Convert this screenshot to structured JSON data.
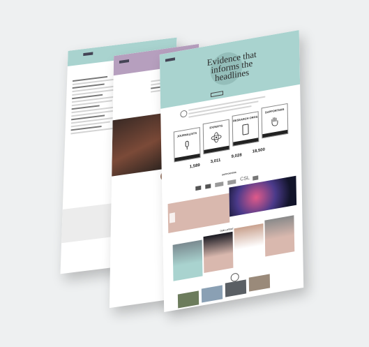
{
  "hero": {
    "title": "Evidence that informs the headlines"
  },
  "audiences": [
    {
      "label": "JOURNALISTS",
      "icon": "microphone-icon"
    },
    {
      "label": "EXPERTS",
      "icon": "atom-icon"
    },
    {
      "label": "RESEARCH ORGS",
      "icon": "phone-icon"
    },
    {
      "label": "SUPPORTERS",
      "icon": "hand-icon"
    }
  ],
  "stats": [
    {
      "value": "1,589"
    },
    {
      "value": "3,011"
    },
    {
      "value": "9,028"
    },
    {
      "value": "18,500"
    }
  ],
  "sections": {
    "supporters_heading": "SUPPORTERS",
    "latest_heading": "OUR LATEST",
    "experts_label": "EXPERTS",
    "supporter_logo_text": "CSL"
  },
  "colors": {
    "teal": "#a9d3cf",
    "mauve": "#b69fbe",
    "blush": "#d9b8ae",
    "dark": "#222222"
  }
}
